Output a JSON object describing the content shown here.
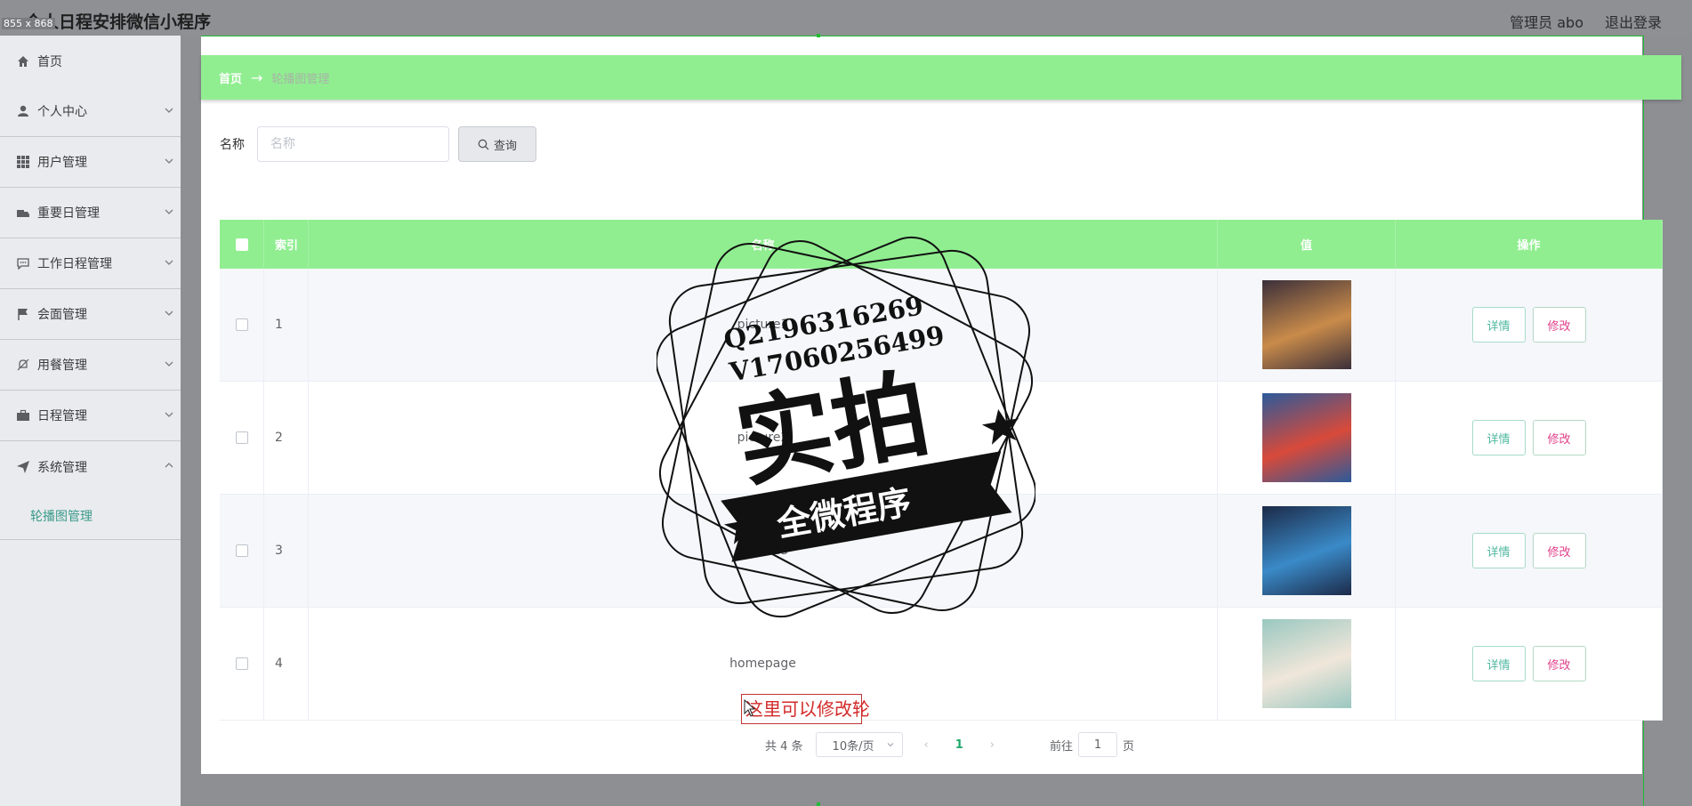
{
  "app": {
    "title": "个人日程安排微信小程序",
    "size_tag": "855 x 868"
  },
  "header": {
    "user": "管理员 abo",
    "logout": "退出登录"
  },
  "sidebar": {
    "items": [
      {
        "label": "首页",
        "icon": "home-icon"
      },
      {
        "label": "个人中心",
        "icon": "user-icon"
      },
      {
        "label": "用户管理",
        "icon": "grid-icon"
      },
      {
        "label": "重要日管理",
        "icon": "truck-icon"
      },
      {
        "label": "工作日程管理",
        "icon": "chat-icon"
      },
      {
        "label": "会面管理",
        "icon": "flag-icon"
      },
      {
        "label": "用餐管理",
        "icon": "bell-off-icon"
      },
      {
        "label": "日程管理",
        "icon": "briefcase-icon"
      },
      {
        "label": "系统管理",
        "icon": "send-icon"
      }
    ],
    "subitem": {
      "label": "轮播图管理"
    }
  },
  "breadcrumb": {
    "home": "首页",
    "arrow": "→",
    "current": "轮播图管理"
  },
  "search": {
    "label": "名称",
    "placeholder": "名称",
    "button": "查询"
  },
  "table": {
    "headers": {
      "index": "索引",
      "name": "名称",
      "value": "值",
      "ops": "操作"
    },
    "rows": [
      {
        "index": "1",
        "name": "picture1",
        "thumb_colors": [
          "#3b2f3a",
          "#c98b4a"
        ]
      },
      {
        "index": "2",
        "name": "picture2",
        "thumb_colors": [
          "#2c5a9a",
          "#d84a3a"
        ]
      },
      {
        "index": "3",
        "name": "picture3",
        "thumb_colors": [
          "#1c2a48",
          "#3a8ac8"
        ]
      },
      {
        "index": "4",
        "name": "homepage",
        "thumb_colors": [
          "#9ac8c0",
          "#f0e6da"
        ]
      }
    ],
    "detail_label": "详情",
    "edit_label": "修改"
  },
  "pager": {
    "total": "共 4 条",
    "page_size": "10条/页",
    "current": "1",
    "goto_label": "前往",
    "goto_value": "1",
    "page_unit": "页"
  },
  "stamp": {
    "line1": "Q2196316269",
    "line2": "V17060256499",
    "big": "实拍",
    "banner": "全微程序"
  },
  "tooltip": {
    "text": "这里可以修改轮"
  },
  "colors": {
    "accent": "#90ee90",
    "detail": "#4fb8a0",
    "edit": "#e0408a"
  }
}
